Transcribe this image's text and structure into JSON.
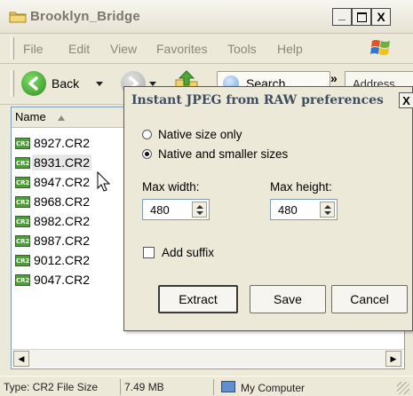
{
  "window": {
    "title": "Brooklyn_Bridge",
    "minimize": "_",
    "maximize": "□",
    "close": "X"
  },
  "menu": {
    "items": [
      "File",
      "Edit",
      "View",
      "Favorites",
      "Tools",
      "Help"
    ]
  },
  "toolbar": {
    "back_label": "Back",
    "search_label": "Search",
    "overflow": "»",
    "address_label": "Address"
  },
  "list": {
    "column_name": "Name",
    "files": [
      "8927.CR2",
      "8931.CR2",
      "8947.CR2",
      "8968.CR2",
      "8982.CR2",
      "8987.CR2",
      "9012.CR2",
      "9047.CR2"
    ],
    "icon_text": "CR2",
    "selected_file": "8931.CR2"
  },
  "status": {
    "type": "Type: CR2 File Size",
    "size": "7.49 MB",
    "location": "My Computer"
  },
  "dialog": {
    "title": "Instant JPEG from RAW preferences",
    "close": "X",
    "radio_native_only": "Native size only",
    "radio_native_smaller": "Native and smaller sizes",
    "selected_option": "Native and smaller sizes",
    "max_width_label": "Max width:",
    "max_height_label": "Max height:",
    "max_width_value": "480",
    "max_height_value": "480",
    "add_suffix_label": "Add suffix",
    "add_suffix_checked": false,
    "btn_extract": "Extract",
    "btn_save": "Save",
    "btn_cancel": "Cancel"
  },
  "colors": {
    "accent_green": "#4f9d3a",
    "dialog_title": "#404d5e",
    "chrome": "#ece9d8"
  }
}
